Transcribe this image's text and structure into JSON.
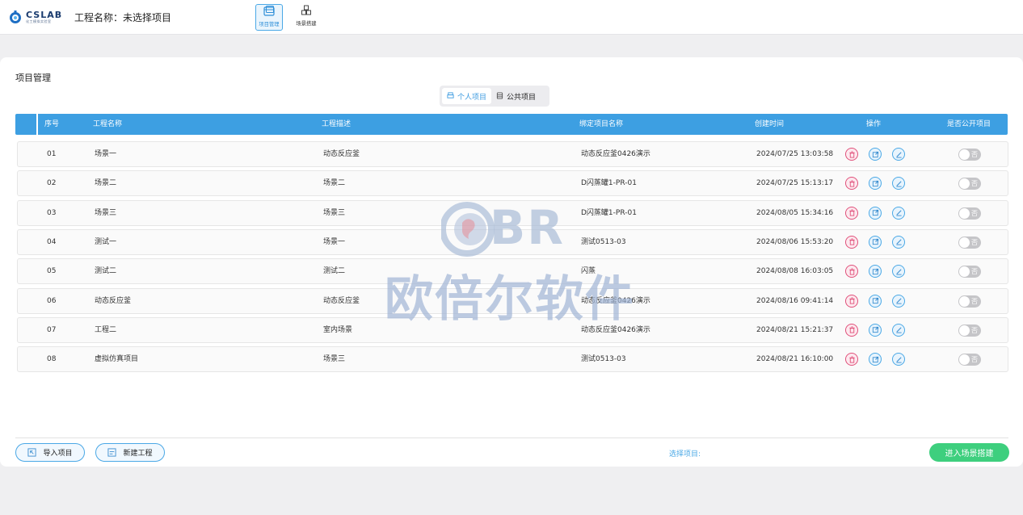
{
  "header": {
    "logo_text": "CSLAB",
    "logo_sub": "化工模拟实验室",
    "project_label": "工程名称：",
    "project_value": "未选择项目",
    "nav": [
      {
        "label": "项目管理",
        "icon": "window-icon",
        "active": true
      },
      {
        "label": "场景搭建",
        "icon": "boxes-icon",
        "active": false
      }
    ]
  },
  "panel": {
    "title": "项目管理",
    "tabs": [
      {
        "label": "个人项目",
        "active": true
      },
      {
        "label": "公共项目",
        "active": false
      }
    ],
    "columns": [
      "序号",
      "工程名称",
      "工程描述",
      "绑定项目名称",
      "创建时间",
      "操作",
      "是否公开项目"
    ],
    "rows": [
      {
        "no": "01",
        "name": "场景一",
        "desc": "动态反应釜",
        "bound": "动态反应釜0426演示",
        "time": "2024/07/25 13:03:58",
        "public": "否"
      },
      {
        "no": "02",
        "name": "场景二",
        "desc": "场景二",
        "bound": "D闪蒸罐1-PR-01",
        "time": "2024/07/25 15:13:17",
        "public": "否"
      },
      {
        "no": "03",
        "name": "场景三",
        "desc": "场景三",
        "bound": "D闪蒸罐1-PR-01",
        "time": "2024/08/05 15:34:16",
        "public": "否"
      },
      {
        "no": "04",
        "name": "测试一",
        "desc": "场景一",
        "bound": "测试0513-03",
        "time": "2024/08/06 15:53:20",
        "public": "否"
      },
      {
        "no": "05",
        "name": "测试二",
        "desc": "测试二",
        "bound": "闪蒸",
        "time": "2024/08/08 16:03:05",
        "public": "否"
      },
      {
        "no": "06",
        "name": "动态反应釜",
        "desc": "动态反应釜",
        "bound": "动态反应釜0426演示",
        "time": "2024/08/16 09:41:14",
        "public": "否"
      },
      {
        "no": "07",
        "name": "工程二",
        "desc": "室内场景",
        "bound": "动态反应釜0426演示",
        "time": "2024/08/21 15:21:37",
        "public": "否"
      },
      {
        "no": "08",
        "name": "虚拟仿真项目",
        "desc": "场景三",
        "bound": "测试0513-03",
        "time": "2024/08/21 16:10:00",
        "public": "否"
      }
    ],
    "row_ops": [
      "trash-icon",
      "export-icon",
      "edit-icon"
    ]
  },
  "footer": {
    "import_label": "导入项目",
    "create_label": "新建工程",
    "selected_label": "选择项目:",
    "enter_label": "进入场景搭建"
  },
  "watermark": {
    "brand": "BR",
    "text": "欧倍尔软件"
  },
  "colors": {
    "accent": "#3d9fe2",
    "danger": "#e0507a",
    "success": "#3ecf7e",
    "toggle_off": "#c5c5c8"
  }
}
